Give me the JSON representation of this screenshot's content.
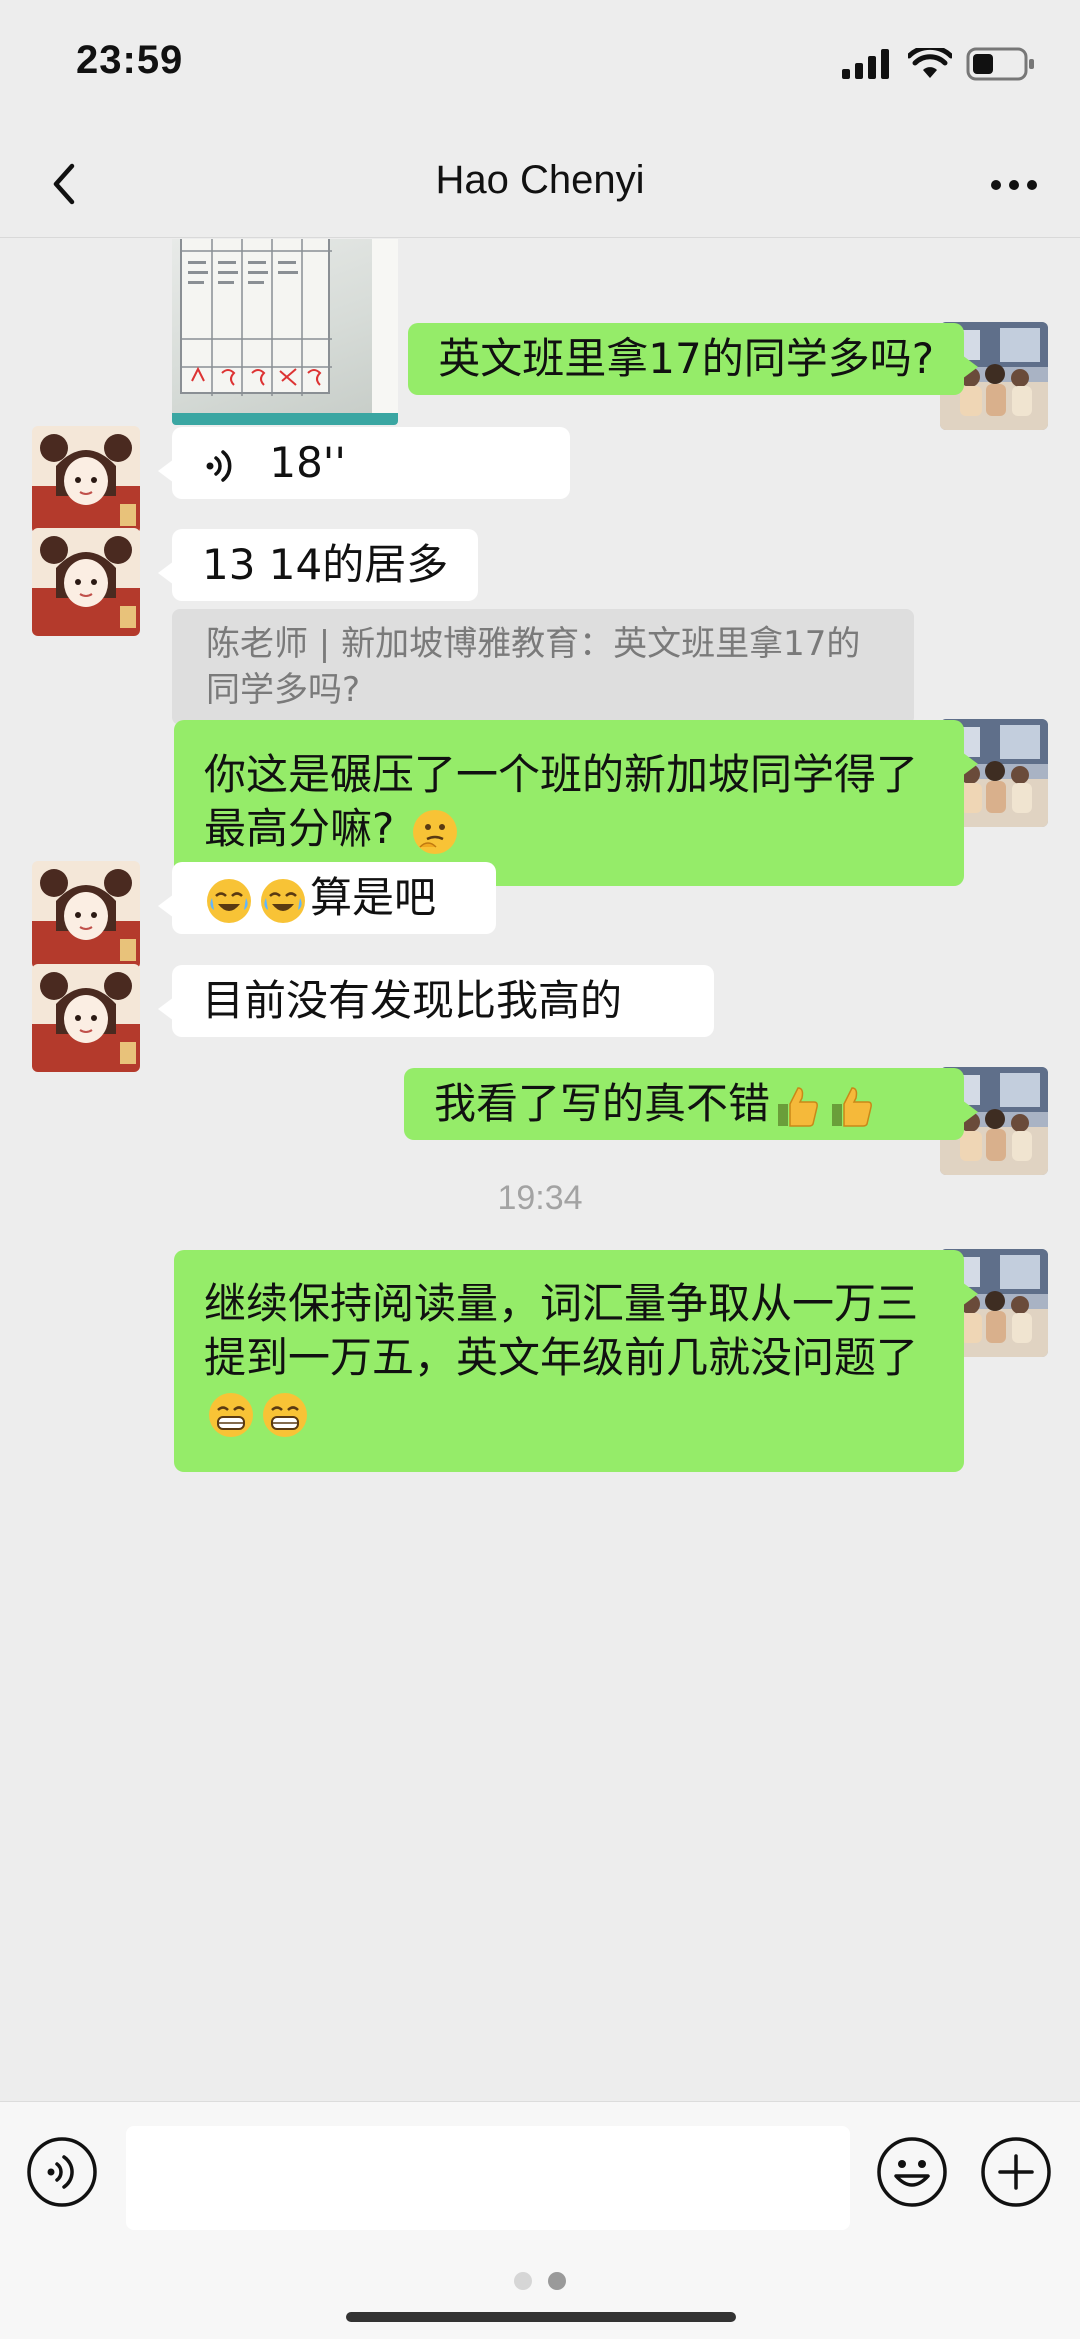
{
  "status": {
    "time": "23:59"
  },
  "nav": {
    "title": "Hao Chenyi"
  },
  "messages": {
    "m1": "英文班里拿17的同学多吗?",
    "m2_voice": "18''",
    "m3": "13 14的居多",
    "m3_quote": "陈老师 | 新加坡博雅教育：英文班里拿17的同学多吗?",
    "m4": "你这是碾压了一个班的新加坡同学得了最高分嘛?",
    "m5": "算是吧",
    "m6": "目前没有发现比我高的",
    "m7": "我看了写的真不错",
    "timestamp": "19:34",
    "m8": "继续保持阅读量，词汇量争取从一万三提到一万五，英文年级前几就没问题了"
  },
  "icons": {
    "voice": "voice-input-icon",
    "emoji": "emoji-icon",
    "plus": "plus-icon"
  }
}
